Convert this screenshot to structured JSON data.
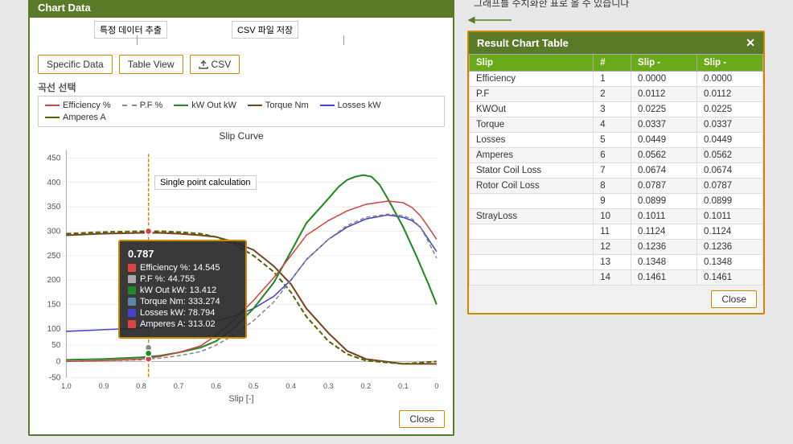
{
  "annotations": {
    "specific_data_label": "특정 데이터 추출",
    "csv_save_label": "CSV 파일 저장",
    "table_description": "그래프를 수치화한 표로 볼 수 있습니다"
  },
  "left_panel": {
    "header": "Chart Data",
    "toolbar": {
      "specific_data": "Specific Data",
      "table_view": "Table View",
      "csv": "CSV"
    },
    "section_label": "곡선 선택",
    "chart_title": "Slip Curve",
    "legend": [
      {
        "label": "Efficiency %",
        "color": "#cc4444",
        "dash": false
      },
      {
        "label": "P.F %",
        "color": "#888888",
        "dash": true
      },
      {
        "label": "kW Out kW",
        "color": "#228822",
        "dash": false
      },
      {
        "label": "Torque Nm",
        "color": "#774422",
        "dash": false
      },
      {
        "label": "Losses kW",
        "color": "#4444cc",
        "dash": false
      },
      {
        "label": "Amperes A",
        "color": "#556600",
        "dash": true
      }
    ],
    "tooltip": {
      "slip_value": "0.787",
      "single_point_label": "Single point calculation",
      "rows": [
        {
          "label": "Efficiency %:",
          "value": "14.545",
          "color": "#dd4444"
        },
        {
          "label": "P.F %:",
          "value": "44.755",
          "color": "#aaaaaa"
        },
        {
          "label": "kW Out kW:",
          "value": "13.412",
          "color": "#228822"
        },
        {
          "label": "Torque Nm:",
          "value": "333.274",
          "color": "#5588aa"
        },
        {
          "label": "Losses kW:",
          "value": "78.794",
          "color": "#4444cc"
        },
        {
          "label": "Amperes A:",
          "value": "313.02",
          "color": "#dd4444"
        }
      ]
    },
    "xaxis_label": "Slip [-]",
    "yaxis_values": [
      "450",
      "400",
      "350",
      "300",
      "250",
      "200",
      "150",
      "100",
      "50",
      "0",
      "-50"
    ],
    "xaxis_ticks": [
      "1.0",
      "0.9",
      "0.8",
      "0.7",
      "0.6",
      "0.5",
      "0.4",
      "0.3",
      "0.2",
      "0.1",
      "0"
    ],
    "close_label": "Close"
  },
  "right_panel": {
    "header": "Result Chart Table",
    "col_headers": [
      "Slip",
      "#",
      "Slip -",
      "Slip -"
    ],
    "rows": [
      {
        "label": "Efficiency",
        "num": "1",
        "v1": "0.0000",
        "v2": "0.0000"
      },
      {
        "label": "P.F",
        "num": "2",
        "v1": "0.0112",
        "v2": "0.0112"
      },
      {
        "label": "KWOut",
        "num": "3",
        "v1": "0.0225",
        "v2": "0.0225"
      },
      {
        "label": "Torque",
        "num": "4",
        "v1": "0.0337",
        "v2": "0.0337"
      },
      {
        "label": "Losses",
        "num": "5",
        "v1": "0.0449",
        "v2": "0.0449"
      },
      {
        "label": "Amperes",
        "num": "6",
        "v1": "0.0562",
        "v2": "0.0562"
      },
      {
        "label": "Stator Coil Loss",
        "num": "7",
        "v1": "0.0674",
        "v2": "0.0674"
      },
      {
        "label": "Rotor Coil Loss",
        "num": "8",
        "v1": "0.0787",
        "v2": "0.0787"
      },
      {
        "label": "",
        "num": "9",
        "v1": "0.0899",
        "v2": "0.0899"
      },
      {
        "label": "StrayLoss",
        "num": "10",
        "v1": "0.1011",
        "v2": "0.1011"
      },
      {
        "label": "",
        "num": "11",
        "v1": "0.1124",
        "v2": "0.1124"
      },
      {
        "label": "",
        "num": "12",
        "v1": "0.1236",
        "v2": "0.1236"
      },
      {
        "label": "",
        "num": "13",
        "v1": "0.1348",
        "v2": "0.1348"
      },
      {
        "label": "",
        "num": "14",
        "v1": "0.1461",
        "v2": "0.1461"
      }
    ],
    "close_label": "Close"
  }
}
